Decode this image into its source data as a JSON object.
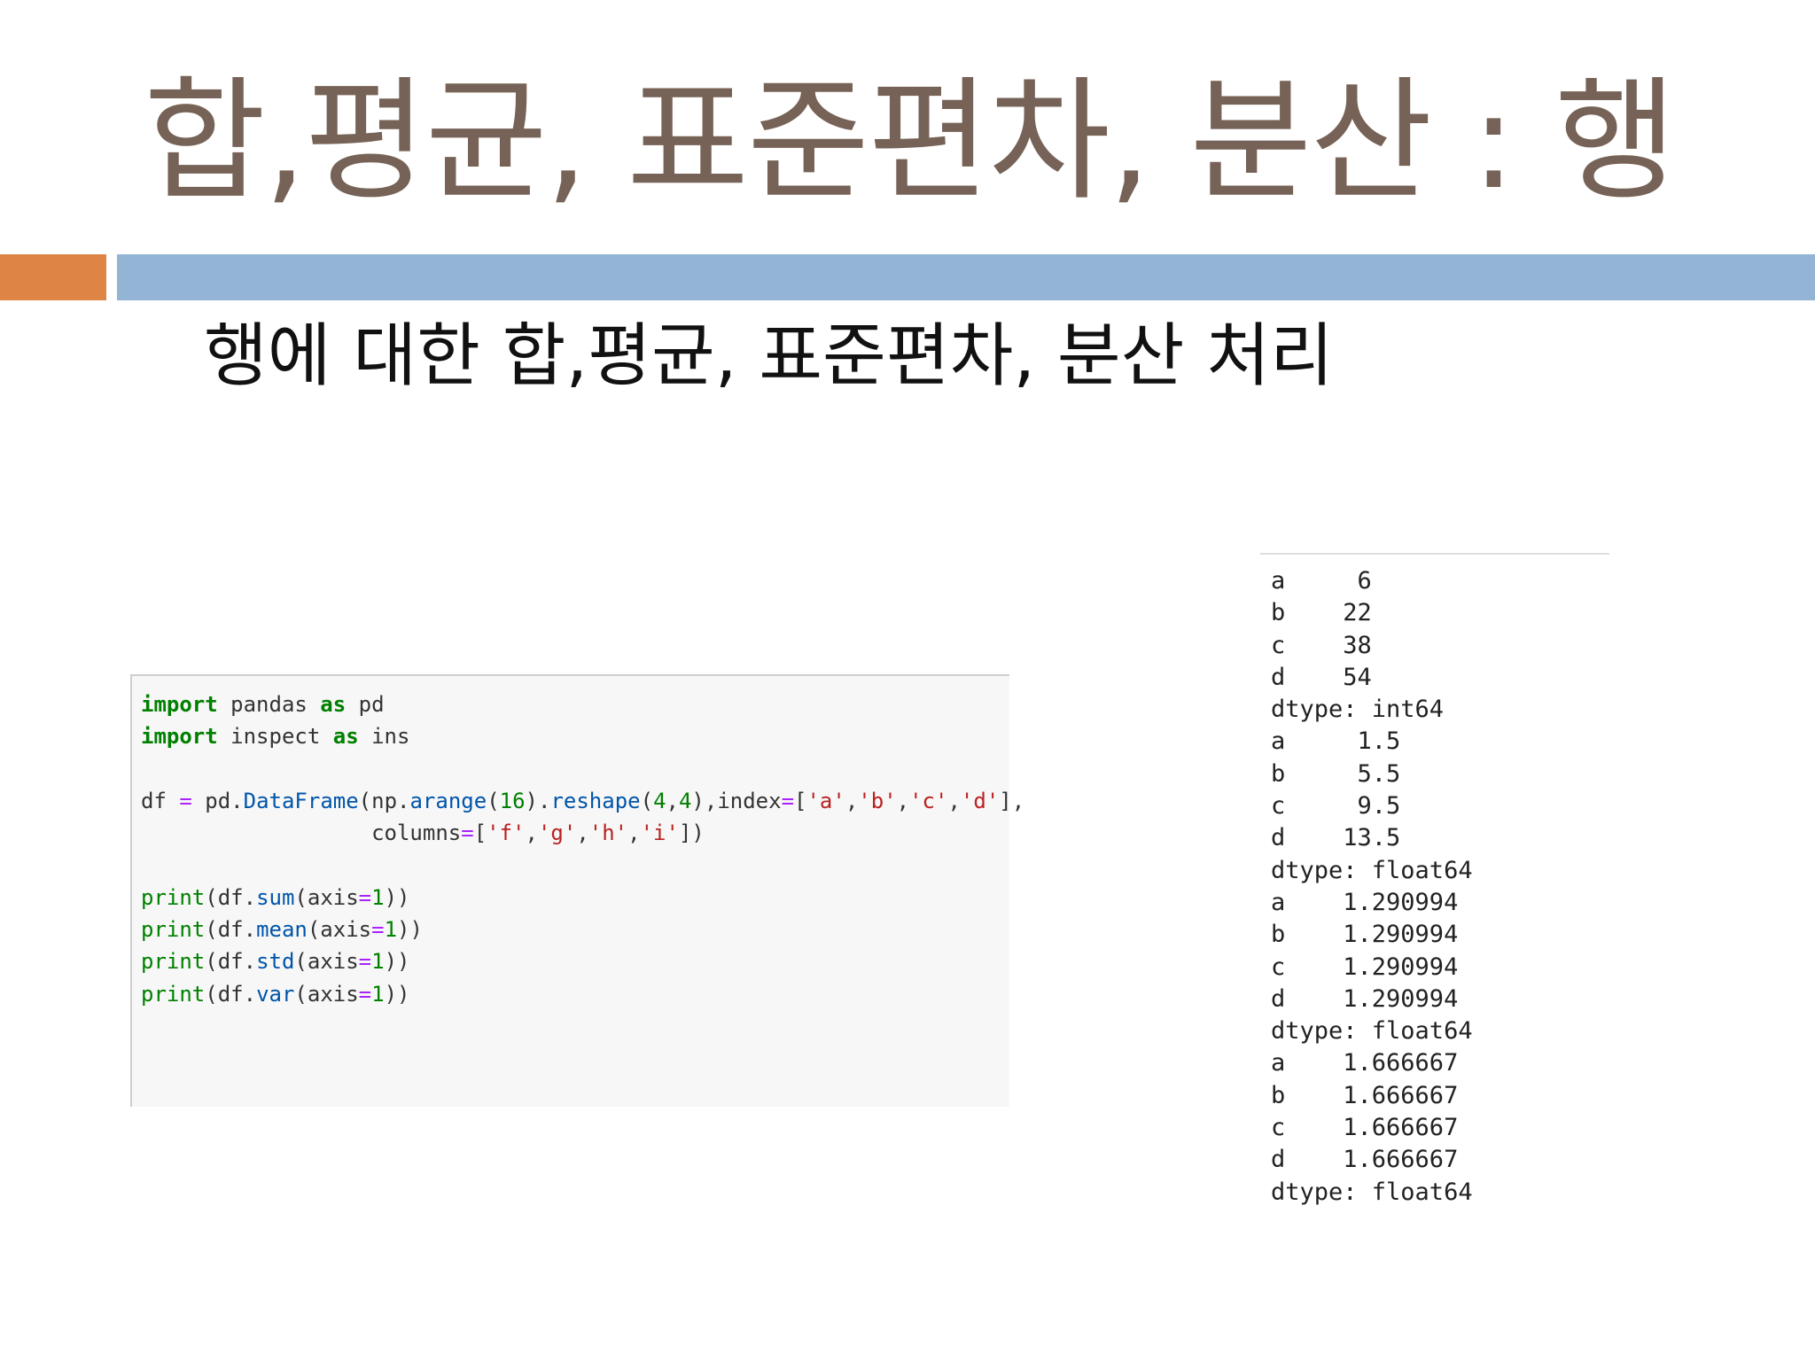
{
  "slide": {
    "title": "합,평균, 표준편차, 분산 : 행",
    "subtitle": "행에 대한 합,평균, 표준편차, 분산 처리",
    "accent_orange": "#DE8545",
    "accent_blue": "#93B4D4",
    "title_color": "#766256"
  },
  "code": {
    "l1": {
      "k1": "import",
      "t1": " pandas ",
      "k2": "as",
      "t2": " pd"
    },
    "l2": {
      "k1": "import",
      "t1": " inspect ",
      "k2": "as",
      "t2": " ins"
    },
    "l4": {
      "t1": "df ",
      "op1": "=",
      "t2": " pd",
      "t3": ".",
      "a1": "DataFrame",
      "t4": "(np",
      "t5": ".",
      "a2": "arange",
      "t6": "(",
      "n1": "16",
      "t7": ")",
      "t8": ".",
      "a3": "reshape",
      "t9": "(",
      "n2": "4",
      "t10": ",",
      "n3": "4",
      "t11": "),index",
      "op2": "=",
      "t12": "[",
      "s1": "'a'",
      "t13": ",",
      "s2": "'b'",
      "t14": ",",
      "s3": "'c'",
      "t15": ",",
      "s4": "'d'",
      "t16": "],"
    },
    "l5": {
      "t1": "                  columns",
      "op1": "=",
      "t2": "[",
      "s1": "'f'",
      "t3": ",",
      "s2": "'g'",
      "t4": ",",
      "s3": "'h'",
      "t5": ",",
      "s4": "'i'",
      "t6": "])"
    },
    "l7": {
      "b1": "print",
      "t1": "(df",
      "t2": ".",
      "a1": "sum",
      "t3": "(axis",
      "op1": "=",
      "n1": "1",
      "t4": "))"
    },
    "l8": {
      "b1": "print",
      "t1": "(df",
      "t2": ".",
      "a1": "mean",
      "t3": "(axis",
      "op1": "=",
      "n1": "1",
      "t4": "))"
    },
    "l9": {
      "b1": "print",
      "t1": "(df",
      "t2": ".",
      "a1": "std",
      "t3": "(axis",
      "op1": "=",
      "n1": "1",
      "t4": "))"
    },
    "l10": {
      "b1": "print",
      "t1": "(df",
      "t2": ".",
      "a1": "var",
      "t3": "(axis",
      "op1": "=",
      "n1": "1",
      "t4": "))"
    }
  },
  "output": [
    "a     6",
    "b    22",
    "c    38",
    "d    54",
    "dtype: int64",
    "a     1.5",
    "b     5.5",
    "c     9.5",
    "d    13.5",
    "dtype: float64",
    "a    1.290994",
    "b    1.290994",
    "c    1.290994",
    "d    1.290994",
    "dtype: float64",
    "a    1.666667",
    "b    1.666667",
    "c    1.666667",
    "d    1.666667",
    "dtype: float64"
  ]
}
